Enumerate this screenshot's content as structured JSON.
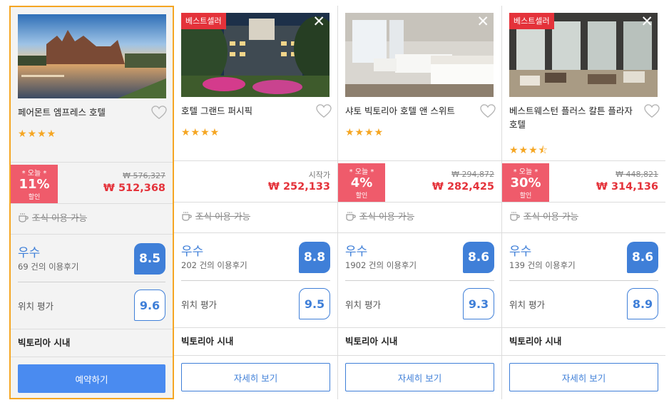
{
  "labels": {
    "bestseller": "베스트셀러",
    "today": "* 오늘 *",
    "discount": "할인",
    "from": "시작가",
    "breakfast": "조식 이용 가능",
    "reviews_suffix": "건의 이용후기",
    "location": "위치 평가",
    "close": "✕",
    "stars_full": "★★★★",
    "stars_three_half": "★★★⯪"
  },
  "colors": {
    "accent": "#3f7fd8",
    "sale": "#e4323a",
    "deal_badge": "#ef5b6b",
    "selected_border": "#f5a623",
    "star": "#f5a623"
  },
  "icons": [
    "heart-icon",
    "close-icon",
    "coffee-cup-icon",
    "star-icon"
  ],
  "hotels": [
    {
      "name": "페어몬트 엠프레스 호텔",
      "rating": 4,
      "deal_pct": "11%",
      "original_price": "₩ 576,327",
      "price": "₩ 512,368",
      "review_word": "우수",
      "review_count": "69 건의 이용후기",
      "score": "8.5",
      "location_score": "9.6",
      "area": "빅토리아 시내",
      "button": "예약하기"
    },
    {
      "name": "호텔 그랜드 퍼시픽",
      "rating": 4,
      "price": "₩ 252,133",
      "review_word": "우수",
      "review_count": "202 건의 이용후기",
      "score": "8.8",
      "location_score": "9.5",
      "area": "빅토리아 시내",
      "button": "자세히 보기"
    },
    {
      "name": "샤토 빅토리아 호텔 앤 스위트",
      "rating": 4,
      "deal_pct": "4%",
      "original_price": "₩ 294,872",
      "price": "₩ 282,425",
      "review_word": "우수",
      "review_count": "1902 건의 이용후기",
      "score": "8.6",
      "location_score": "9.3",
      "area": "빅토리아 시내",
      "button": "자세히 보기"
    },
    {
      "name": "베스트웨스턴 플러스 칼튼 플라자 호텔",
      "rating": 3.5,
      "deal_pct": "30%",
      "original_price": "₩ 448,821",
      "price": "₩ 314,136",
      "review_word": "우수",
      "review_count": "139 건의 이용후기",
      "score": "8.6",
      "location_score": "8.9",
      "area": "빅토리아 시내",
      "button": "자세히 보기"
    }
  ]
}
